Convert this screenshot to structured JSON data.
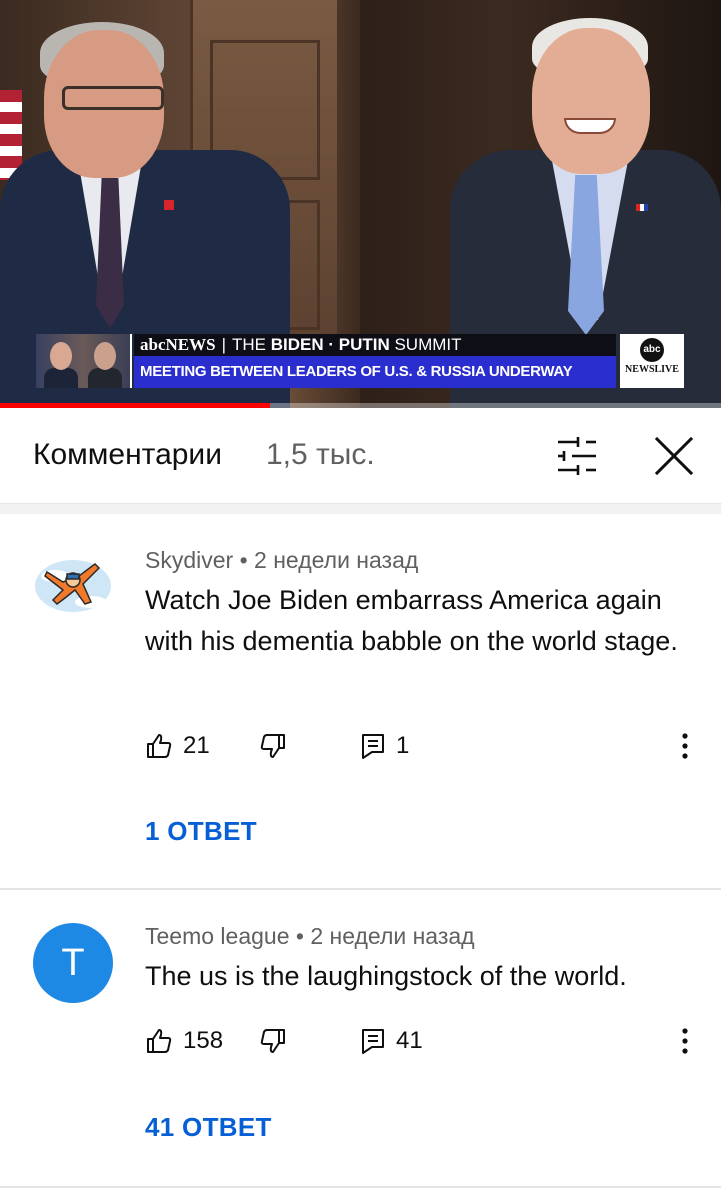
{
  "video": {
    "chyron": {
      "brand": "abcNEWS",
      "divider": "|",
      "summit_the": "THE",
      "summit_names": "BIDEN · PUTIN",
      "summit_word": "SUMMIT",
      "headline": "MEETING BETWEEN LEADERS OF U.S. & RUSSIA UNDERWAY"
    },
    "logo": {
      "circle": "abc",
      "live": "NEWSLIVE"
    },
    "progress_fraction": 0.375
  },
  "comments_panel": {
    "title": "Комментарии",
    "count": "1,5 тыс.",
    "sort_icon": "sort-filter-icon",
    "close_icon": "close-icon"
  },
  "comments": [
    {
      "author": "Skydiver",
      "time": "• 2 недели назад",
      "text": "Watch Joe Biden embarrass America again with his dementia babble on the world stage.",
      "likes": "21",
      "replies_count": "1",
      "replies_link": "1 ОТВЕТ",
      "avatar_letter": ""
    },
    {
      "author": "Teemo league",
      "time": "• 2 недели назад",
      "text": "The us is the laughingstock  of the world.",
      "likes": "158",
      "replies_count": "41",
      "replies_link": "41 ОТВЕТ",
      "avatar_letter": "T"
    }
  ],
  "colors": {
    "link": "#065fd4",
    "progress": "#ff0000",
    "avatar_t": "#1e88e5"
  }
}
